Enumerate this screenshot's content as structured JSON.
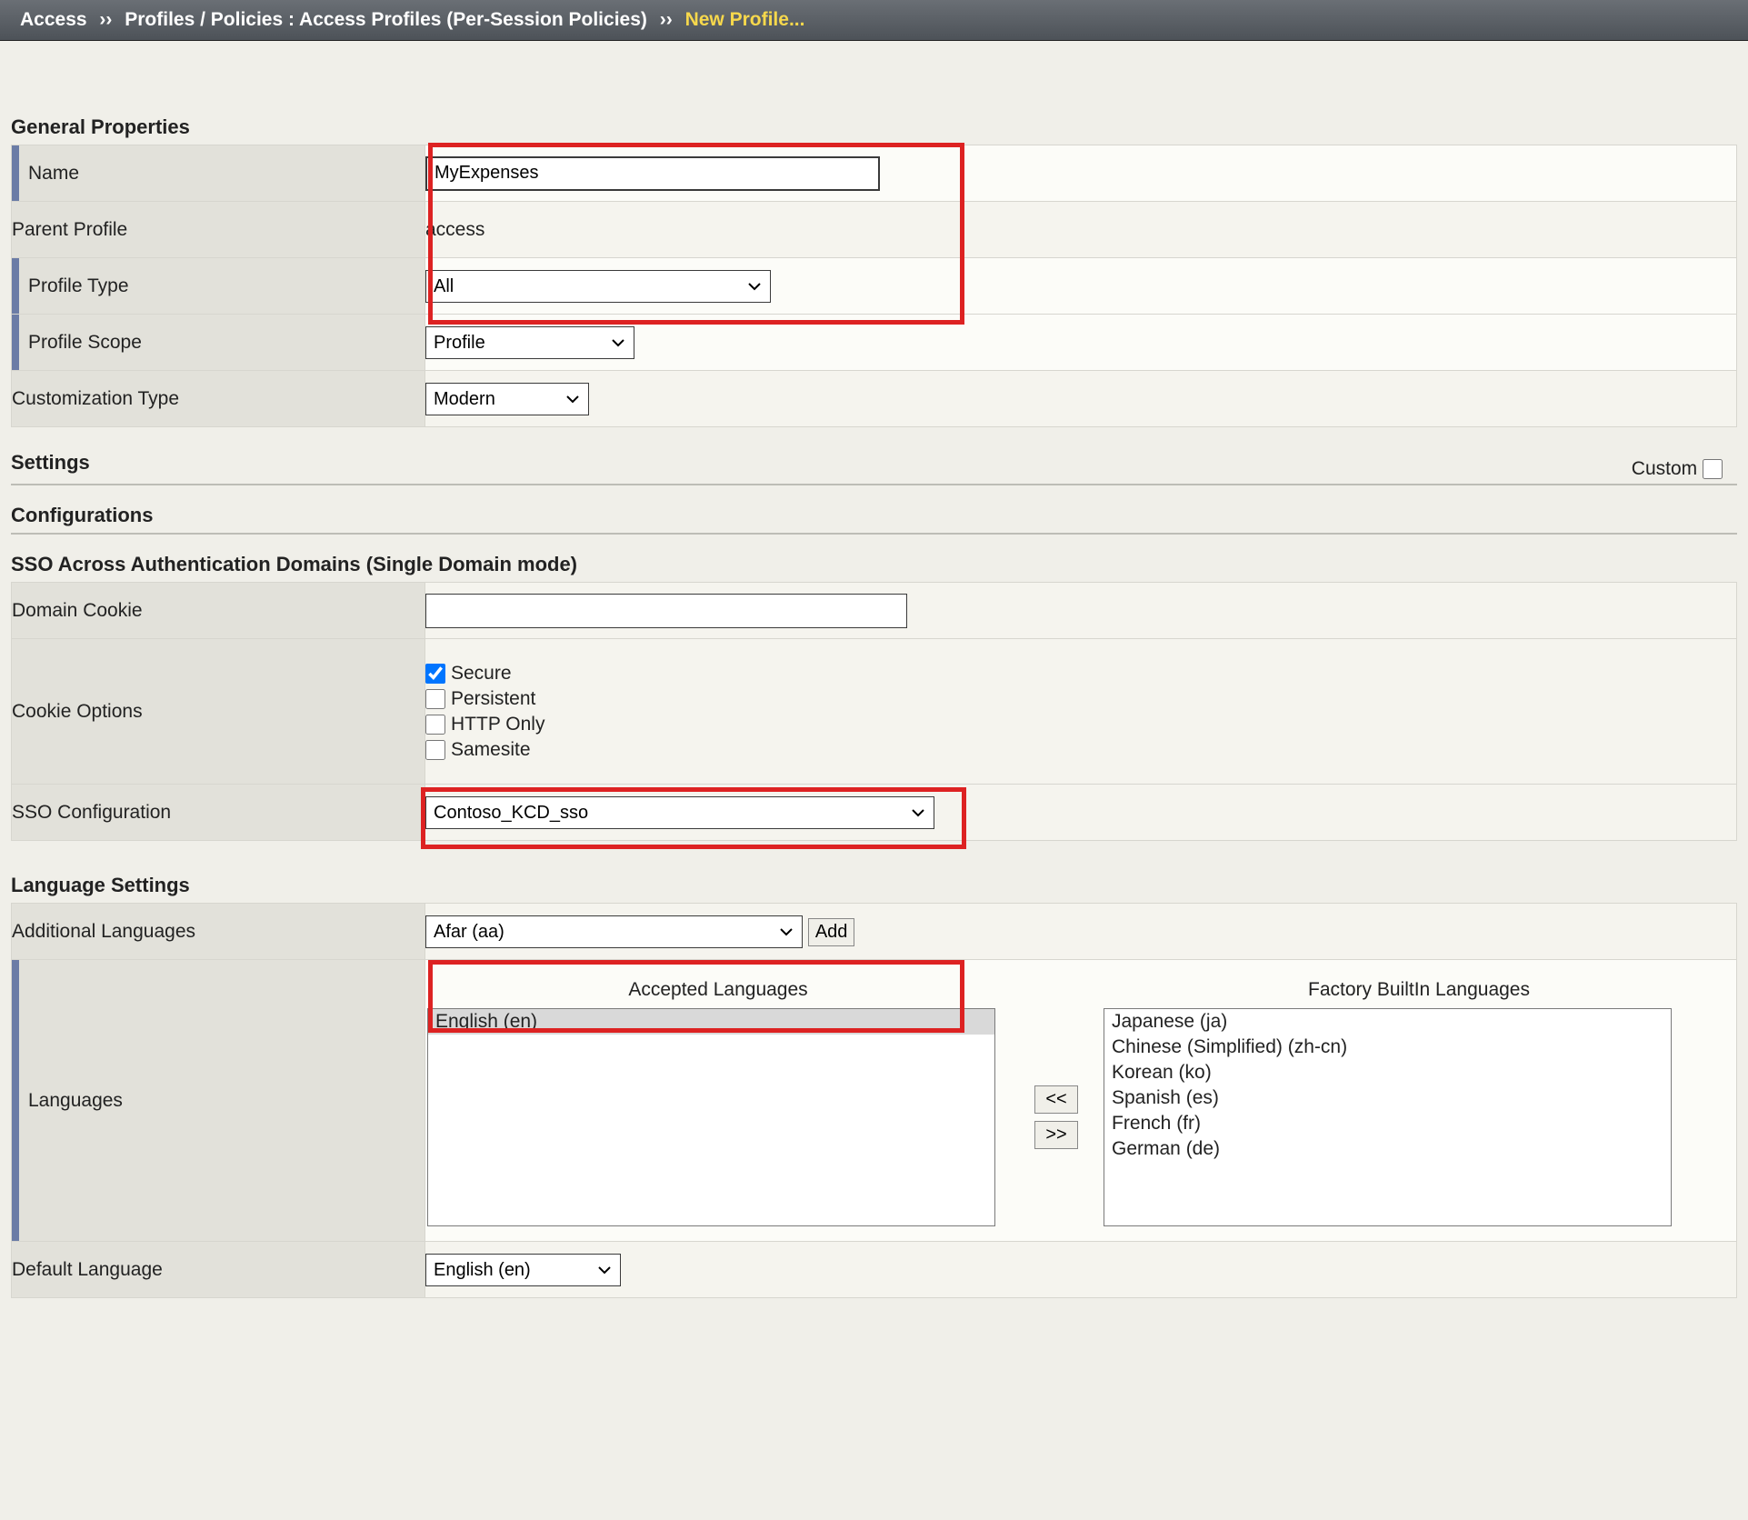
{
  "breadcrumb": {
    "root": "Access",
    "sep": "››",
    "mid": "Profiles / Policies : Access Profiles (Per-Session Policies)",
    "current": "New Profile..."
  },
  "sections": {
    "general": "General Properties",
    "settings": "Settings",
    "configurations": "Configurations",
    "sso_domains": "SSO Across Authentication Domains (Single Domain mode)",
    "language": "Language Settings"
  },
  "general": {
    "name_label": "Name",
    "name_value": "MyExpenses",
    "parent_label": "Parent Profile",
    "parent_value": "access",
    "profile_type_label": "Profile Type",
    "profile_type_value": "All",
    "profile_scope_label": "Profile Scope",
    "profile_scope_value": "Profile",
    "custom_type_label": "Customization Type",
    "custom_type_value": "Modern"
  },
  "settings": {
    "custom_label": "Custom"
  },
  "sso": {
    "domain_cookie_label": "Domain Cookie",
    "domain_cookie_value": "",
    "cookie_options_label": "Cookie Options",
    "secure_label": "Secure",
    "persistent_label": "Persistent",
    "httponly_label": "HTTP Only",
    "samesite_label": "Samesite",
    "sso_config_label": "SSO Configuration",
    "sso_config_value": "Contoso_KCD_sso"
  },
  "lang": {
    "addl_lang_label": "Additional Languages",
    "addl_lang_value": "Afar (aa)",
    "add_button": "Add",
    "languages_label": "Languages",
    "accepted_header": "Accepted Languages",
    "factory_header": "Factory BuiltIn Languages",
    "move_left": "<<",
    "move_right": ">>",
    "accepted": [
      "English (en)"
    ],
    "factory": [
      "Japanese (ja)",
      "Chinese (Simplified) (zh-cn)",
      "Korean (ko)",
      "Spanish (es)",
      "French (fr)",
      "German (de)"
    ],
    "default_lang_label": "Default Language",
    "default_lang_value": "English (en)"
  }
}
